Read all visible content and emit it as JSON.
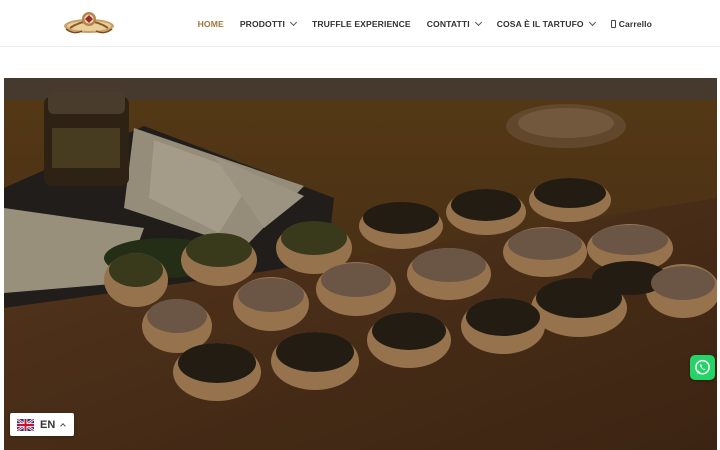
{
  "header": {
    "logo_icon": "truffle-brand-logo",
    "nav": [
      {
        "label": "HOME",
        "active": true,
        "has_dropdown": false
      },
      {
        "label": "PRODOTTI",
        "active": false,
        "has_dropdown": true
      },
      {
        "label": "TRUFFLE EXPERIENCE",
        "active": false,
        "has_dropdown": false
      },
      {
        "label": "CONTATTI",
        "active": false,
        "has_dropdown": true
      },
      {
        "label": "COSA È IL TARTUFO",
        "active": false,
        "has_dropdown": true
      }
    ],
    "cart": {
      "label": "Carrello",
      "icon": "cart-icon"
    }
  },
  "hero": {
    "image": "crostini-with-truffle-spreads-on-wooden-board"
  },
  "whatsapp": {
    "icon": "whatsapp-icon",
    "color": "#25d366"
  },
  "language": {
    "code": "EN",
    "flag": "uk-flag-icon"
  },
  "colors": {
    "accent": "#a0763c",
    "nav_text": "#333333"
  }
}
